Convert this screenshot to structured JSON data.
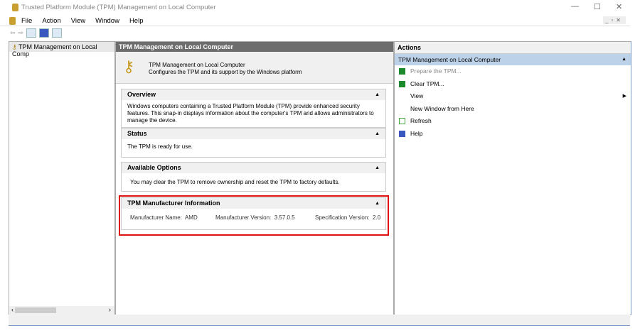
{
  "window": {
    "title": "Trusted Platform Module (TPM) Management on Local Computer"
  },
  "menu": [
    "File",
    "Action",
    "View",
    "Window",
    "Help"
  ],
  "tree": {
    "item": "TPM Management on Local Comp"
  },
  "center": {
    "header": "TPM Management on Local Computer",
    "intro_title": "TPM Management on Local Computer",
    "intro_desc": "Configures the TPM and its support by the Windows platform",
    "overview": {
      "title": "Overview",
      "text": "Windows computers containing a Trusted Platform Module (TPM) provide enhanced security features. This snap-in displays information about the computer's TPM and allows administrators to manage the device."
    },
    "status": {
      "title": "Status",
      "text": "The TPM is ready for use."
    },
    "options": {
      "title": "Available Options",
      "text": "You may clear the TPM to remove ownership and reset the TPM to factory defaults."
    },
    "manufacturer": {
      "title": "TPM Manufacturer Information",
      "name_label": "Manufacturer Name:",
      "name": "AMD",
      "version_label": "Manufacturer Version:",
      "version": "3.57.0.5",
      "spec_label": "Specification Version:",
      "spec": "2.0"
    }
  },
  "actions": {
    "header": "Actions",
    "group": "TPM Management on Local Computer",
    "items": [
      "Prepare the TPM...",
      "Clear TPM...",
      "View",
      "New Window from Here",
      "Refresh",
      "Help"
    ]
  },
  "colors": {
    "highlight": "#e01010",
    "group_bg": "#bcd2e8"
  }
}
